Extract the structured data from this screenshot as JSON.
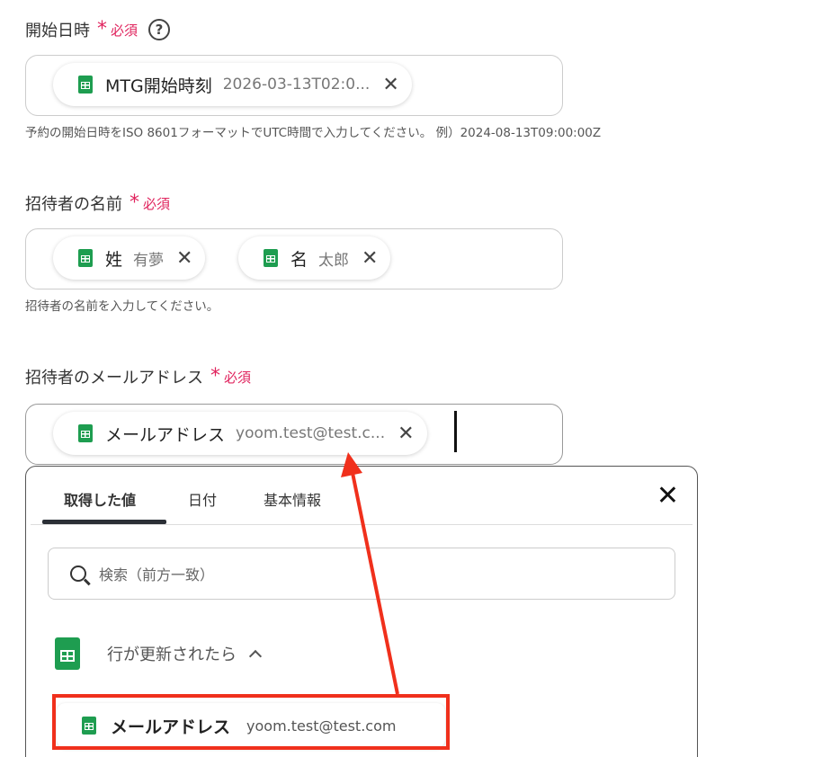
{
  "fields": {
    "start": {
      "label": "開始日時",
      "required": "必須",
      "help_icon": "?",
      "pill": {
        "name": "MTG開始時刻",
        "value": "2026-03-13T02:0..."
      },
      "hint": "予約の開始日時をISO 8601フォーマットでUTC時間で入力してください。 例）2024-08-13T09:00:00Z"
    },
    "name": {
      "label": "招待者の名前",
      "required": "必須",
      "pills": [
        {
          "name": "姓",
          "value": "有夢"
        },
        {
          "name": "名",
          "value": "太郎"
        }
      ],
      "hint": "招待者の名前を入力してください。"
    },
    "email": {
      "label": "招待者のメールアドレス",
      "required": "必須",
      "pill": {
        "name": "メールアドレス",
        "value": "yoom.test@test.c..."
      }
    }
  },
  "panel": {
    "tabs": [
      "取得した値",
      "日付",
      "基本情報"
    ],
    "active_tab": 0,
    "close": "✕",
    "search_placeholder": "検索（前方一致）",
    "group_title": "行が更新されたら",
    "result": {
      "name": "メールアドレス",
      "value": "yoom.test@test.com"
    }
  },
  "icons": {
    "pill_remove": "✕",
    "sheets": "google-sheets-icon",
    "search": "search-icon",
    "chevron": "chevron-up-icon"
  },
  "colors": {
    "required": "#e0245e",
    "sheets_green": "#1e9d50",
    "annotation_red": "#f0301c"
  }
}
